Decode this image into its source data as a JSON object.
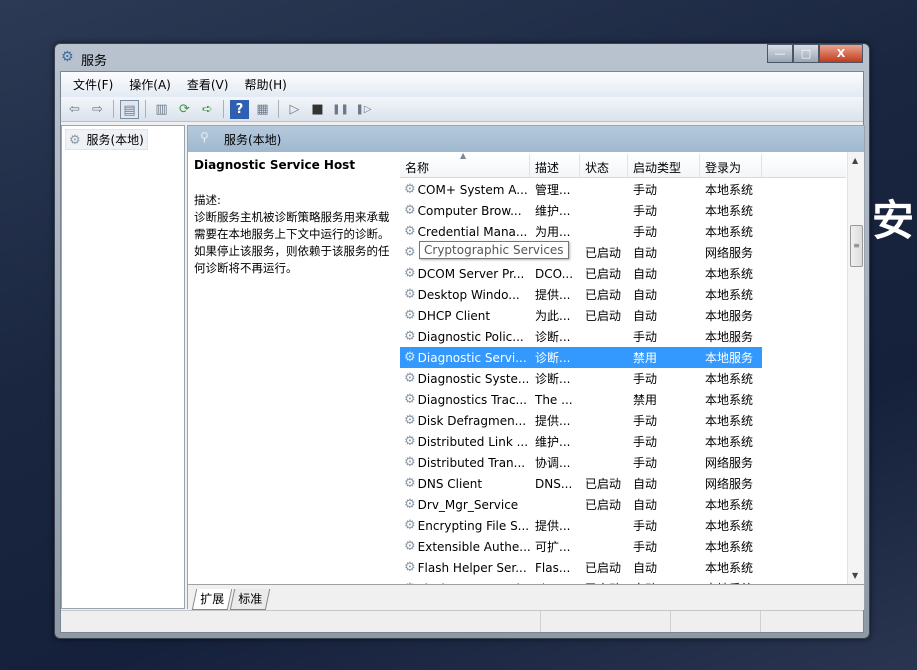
{
  "window": {
    "title": "服务",
    "buttons": {
      "minimize": "—",
      "maximize": "□",
      "close": "X"
    }
  },
  "menu": [
    "文件(F)",
    "操作(A)",
    "查看(V)",
    "帮助(H)"
  ],
  "toolbar": {
    "back": "⇦",
    "forward": "⇨",
    "console": "▤",
    "properties": "▥",
    "refresh": "⟳",
    "export": "➪",
    "help": "?",
    "view": "▦",
    "start": "▷",
    "stop": "■",
    "pause": "❚❚",
    "resume": "❚▷"
  },
  "tree": {
    "item": "服务(本地)"
  },
  "pane": {
    "title": "服务(本地)"
  },
  "detail": {
    "name": "Diagnostic Service Host",
    "desc_label": "描述:",
    "desc": "诊断服务主机被诊断策略服务用来承载需要在本地服务上下文中运行的诊断。如果停止该服务，则依赖于该服务的任何诊断将不再运行。"
  },
  "columns": [
    "名称",
    "描述",
    "状态",
    "启动类型",
    "登录为"
  ],
  "rows": [
    {
      "name": "COM+ System A...",
      "desc": "管理...",
      "status": "",
      "startup": "手动",
      "logon": "本地系统"
    },
    {
      "name": "Computer Brow...",
      "desc": "维护...",
      "status": "",
      "startup": "手动",
      "logon": "本地系统"
    },
    {
      "name": "Credential Mana...",
      "desc": "为用...",
      "status": "",
      "startup": "手动",
      "logon": "本地系统"
    },
    {
      "name": "",
      "desc": "..",
      "status": "已启动",
      "startup": "自动",
      "logon": "网络服务"
    },
    {
      "name": "DCOM Server Pr...",
      "desc": "DCO...",
      "status": "已启动",
      "startup": "自动",
      "logon": "本地系统"
    },
    {
      "name": "Desktop Windo...",
      "desc": "提供...",
      "status": "已启动",
      "startup": "自动",
      "logon": "本地系统"
    },
    {
      "name": "DHCP Client",
      "desc": "为此...",
      "status": "已启动",
      "startup": "自动",
      "logon": "本地服务"
    },
    {
      "name": "Diagnostic Polic...",
      "desc": "诊断...",
      "status": "",
      "startup": "手动",
      "logon": "本地服务"
    },
    {
      "name": "Diagnostic Servi...",
      "desc": "诊断...",
      "status": "",
      "startup": "禁用",
      "logon": "本地服务"
    },
    {
      "name": "Diagnostic Syste...",
      "desc": "诊断...",
      "status": "",
      "startup": "手动",
      "logon": "本地系统"
    },
    {
      "name": "Diagnostics Trac...",
      "desc": "The ...",
      "status": "",
      "startup": "禁用",
      "logon": "本地系统"
    },
    {
      "name": "Disk Defragmen...",
      "desc": "提供...",
      "status": "",
      "startup": "手动",
      "logon": "本地系统"
    },
    {
      "name": "Distributed Link ...",
      "desc": "维护...",
      "status": "",
      "startup": "手动",
      "logon": "本地系统"
    },
    {
      "name": "Distributed Tran...",
      "desc": "协调...",
      "status": "",
      "startup": "手动",
      "logon": "网络服务"
    },
    {
      "name": "DNS Client",
      "desc": "DNS...",
      "status": "已启动",
      "startup": "自动",
      "logon": "网络服务"
    },
    {
      "name": "Drv_Mgr_Service",
      "desc": "",
      "status": "已启动",
      "startup": "自动",
      "logon": "本地系统"
    },
    {
      "name": "Encrypting File S...",
      "desc": "提供...",
      "status": "",
      "startup": "手动",
      "logon": "本地系统"
    },
    {
      "name": "Extensible Authe...",
      "desc": "可扩...",
      "status": "",
      "startup": "手动",
      "logon": "本地系统"
    },
    {
      "name": "Flash Helper Ser...",
      "desc": "Flas...",
      "status": "已启动",
      "startup": "自动",
      "logon": "本地系统"
    },
    {
      "name": "FlashCenterServi...",
      "desc": "Flas...",
      "status": "已启动",
      "startup": "自动",
      "logon": "本地系统"
    }
  ],
  "selected_row": 8,
  "tooltip": "Cryptographic Services",
  "tabs": [
    "扩展",
    "标准"
  ],
  "colors": {
    "selection": "#3399ff",
    "header": "#a9c0d6"
  }
}
